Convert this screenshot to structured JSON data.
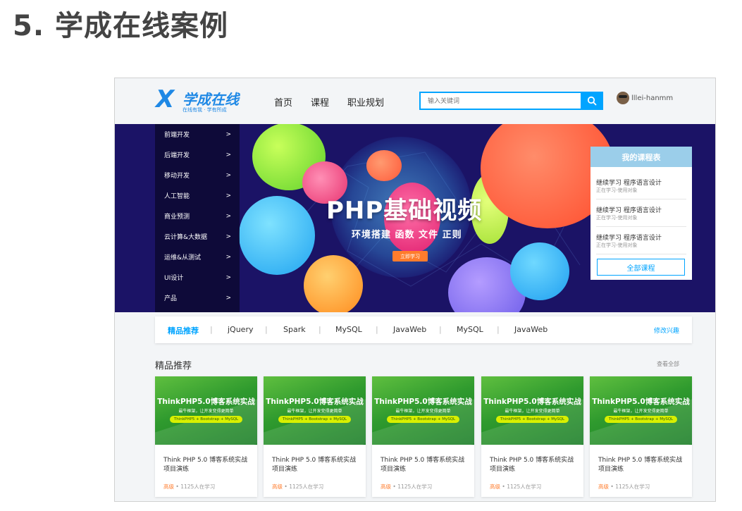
{
  "page_title": "5. 学成在线案例",
  "header": {
    "logo": {
      "main": "学成在线",
      "sub": "在线有我 · 学有所成"
    },
    "nav": [
      "首页",
      "课程",
      "职业规划"
    ],
    "search": {
      "placeholder": "输入关键词"
    },
    "user": {
      "name": "lllei-hanmm"
    }
  },
  "banner": {
    "title": "PHP基础视频",
    "subtitle": "环境搭建  函数  文件  正则",
    "button": "立即学习",
    "menu": [
      {
        "label": "前端开发",
        "arrow": ">"
      },
      {
        "label": "后端开发",
        "arrow": ">"
      },
      {
        "label": "移动开发",
        "arrow": ">"
      },
      {
        "label": "人工智能",
        "arrow": ">"
      },
      {
        "label": "商业预测",
        "arrow": ">"
      },
      {
        "label": "云计算&大数据",
        "arrow": ">"
      },
      {
        "label": "运维&从测试",
        "arrow": ">"
      },
      {
        "label": "UI设计",
        "arrow": ">"
      },
      {
        "label": "产品",
        "arrow": ">"
      }
    ],
    "course_table": {
      "title": "我的课程表",
      "items": [
        {
          "title": "继续学习 程序语言设计",
          "sub": "正在学习-使用对象"
        },
        {
          "title": "继续学习 程序语言设计",
          "sub": "正在学习-使用对象"
        },
        {
          "title": "继续学习 程序语言设计",
          "sub": "正在学习-使用对象"
        }
      ],
      "all_button": "全部课程"
    }
  },
  "tabs": {
    "items": [
      "精品推荐",
      "jQuery",
      "Spark",
      "MySQL",
      "JavaWeb",
      "MySQL",
      "JavaWeb"
    ],
    "separator": "|",
    "edit": "修改兴趣"
  },
  "section": {
    "title": "精品推荐",
    "view_all": "查看全部",
    "products": [
      {
        "thumb_title": "ThinkPHP5.0博客系统实战",
        "thumb_sub": "最牛框架，让开发变得更简单",
        "thumb_pill": "ThinkPHP5 + Bootstrap + MySQL",
        "title": "Think PHP 5.0 博客系统实战项目演练",
        "level": "高级",
        "learners": "• 1125人在学习"
      },
      {
        "thumb_title": "ThinkPHP5.0博客系统实战",
        "thumb_sub": "最牛框架，让开发变得更简单",
        "thumb_pill": "ThinkPHP5 + Bootstrap + MySQL",
        "title": "Think PHP 5.0 博客系统实战项目演练",
        "level": "高级",
        "learners": "• 1125人在学习"
      },
      {
        "thumb_title": "ThinkPHP5.0博客系统实战",
        "thumb_sub": "最牛框架，让开发变得更简单",
        "thumb_pill": "ThinkPHP5 + Bootstrap + MySQL",
        "title": "Think PHP 5.0 博客系统实战项目演练",
        "level": "高级",
        "learners": "• 1125人在学习"
      },
      {
        "thumb_title": "ThinkPHP5.0博客系统实战",
        "thumb_sub": "最牛框架，让开发变得更简单",
        "thumb_pill": "ThinkPHP5 + Bootstrap + MySQL",
        "title": "Think PHP 5.0 博客系统实战项目演练",
        "level": "高级",
        "learners": "• 1125人在学习"
      },
      {
        "thumb_title": "ThinkPHP5.0博客系统实战",
        "thumb_sub": "最牛框架，让开发变得更简单",
        "thumb_pill": "ThinkPHP5 + Bootstrap + MySQL",
        "title": "Think PHP 5.0 博客系统实战项目演练",
        "level": "高级",
        "learners": "• 1125人在学习"
      }
    ]
  },
  "colors": {
    "accent": "#00a4ff",
    "banner_bg": "#1b1366",
    "orange": "#ff7c2d",
    "thumb_green": "#2f9a2e"
  }
}
